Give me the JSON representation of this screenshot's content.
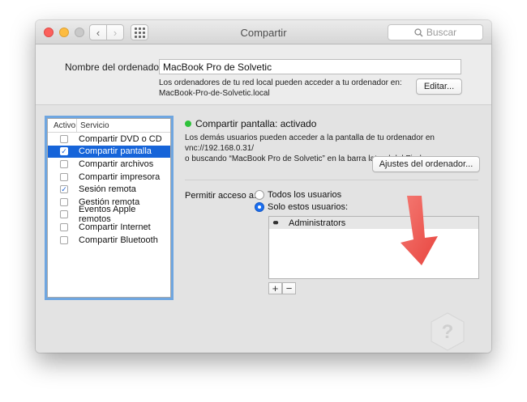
{
  "window": {
    "title": "Compartir"
  },
  "toolbar": {
    "search_placeholder": "Buscar",
    "back": "‹",
    "forward": "›"
  },
  "computer_name": {
    "label": "Nombre del ordenador:",
    "value": "MacBook Pro de Solvetic",
    "info_line1": "Los ordenadores de tu red local pueden acceder a tu ordenador en:",
    "info_line2": "MacBook-Pro-de-Solvetic.local",
    "edit_label": "Editar..."
  },
  "services": {
    "header_active": "Activo",
    "header_service": "Servicio",
    "items": [
      {
        "label": "Compartir DVD o CD",
        "checked": false,
        "selected": false
      },
      {
        "label": "Compartir pantalla",
        "checked": true,
        "selected": true
      },
      {
        "label": "Compartir archivos",
        "checked": false,
        "selected": false
      },
      {
        "label": "Compartir impresora",
        "checked": false,
        "selected": false
      },
      {
        "label": "Sesión remota",
        "checked": true,
        "selected": false
      },
      {
        "label": "Gestión remota",
        "checked": false,
        "selected": false
      },
      {
        "label": "Eventos Apple remotos",
        "checked": false,
        "selected": false
      },
      {
        "label": "Compartir Internet",
        "checked": false,
        "selected": false
      },
      {
        "label": "Compartir Bluetooth",
        "checked": false,
        "selected": false
      }
    ]
  },
  "detail": {
    "status": "Compartir pantalla: activado",
    "status_color": "#2fc23b",
    "desc_line1": "Los demás usuarios pueden acceder a la pantalla de tu ordenador en vnc://192.168.0.31/",
    "desc_line2": "o buscando “MacBook Pro de Solvetic” en la barra lateral del Finder.",
    "settings_label": "Ajustes del ordenador...",
    "access_label": "Permitir acceso a:",
    "radio_all": "Todos los usuarios",
    "radio_these": "Solo estos usuarios:",
    "users": [
      "Administrators"
    ],
    "add": "+",
    "remove": "−"
  },
  "colors": {
    "selection": "#1664d9",
    "arrow": "#f0554f",
    "accent": "#1a6ef0"
  }
}
